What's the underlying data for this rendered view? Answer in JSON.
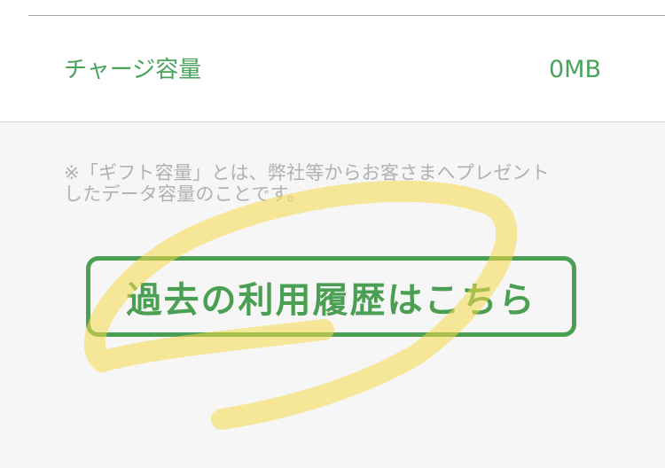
{
  "charge_row": {
    "label": "チャージ容量",
    "value": "0MB"
  },
  "note": {
    "line1": "※「ギフト容量」とは、弊社等からお客さまへプレゼント",
    "line2": "したデータ容量のことです。"
  },
  "history_button": {
    "label": "過去の利用履歴はこちら"
  },
  "colors": {
    "accent": "#4a9f52",
    "note_text": "#b1b1b1",
    "highlighter": "#f5d84a",
    "background": "#f6f6f6"
  }
}
